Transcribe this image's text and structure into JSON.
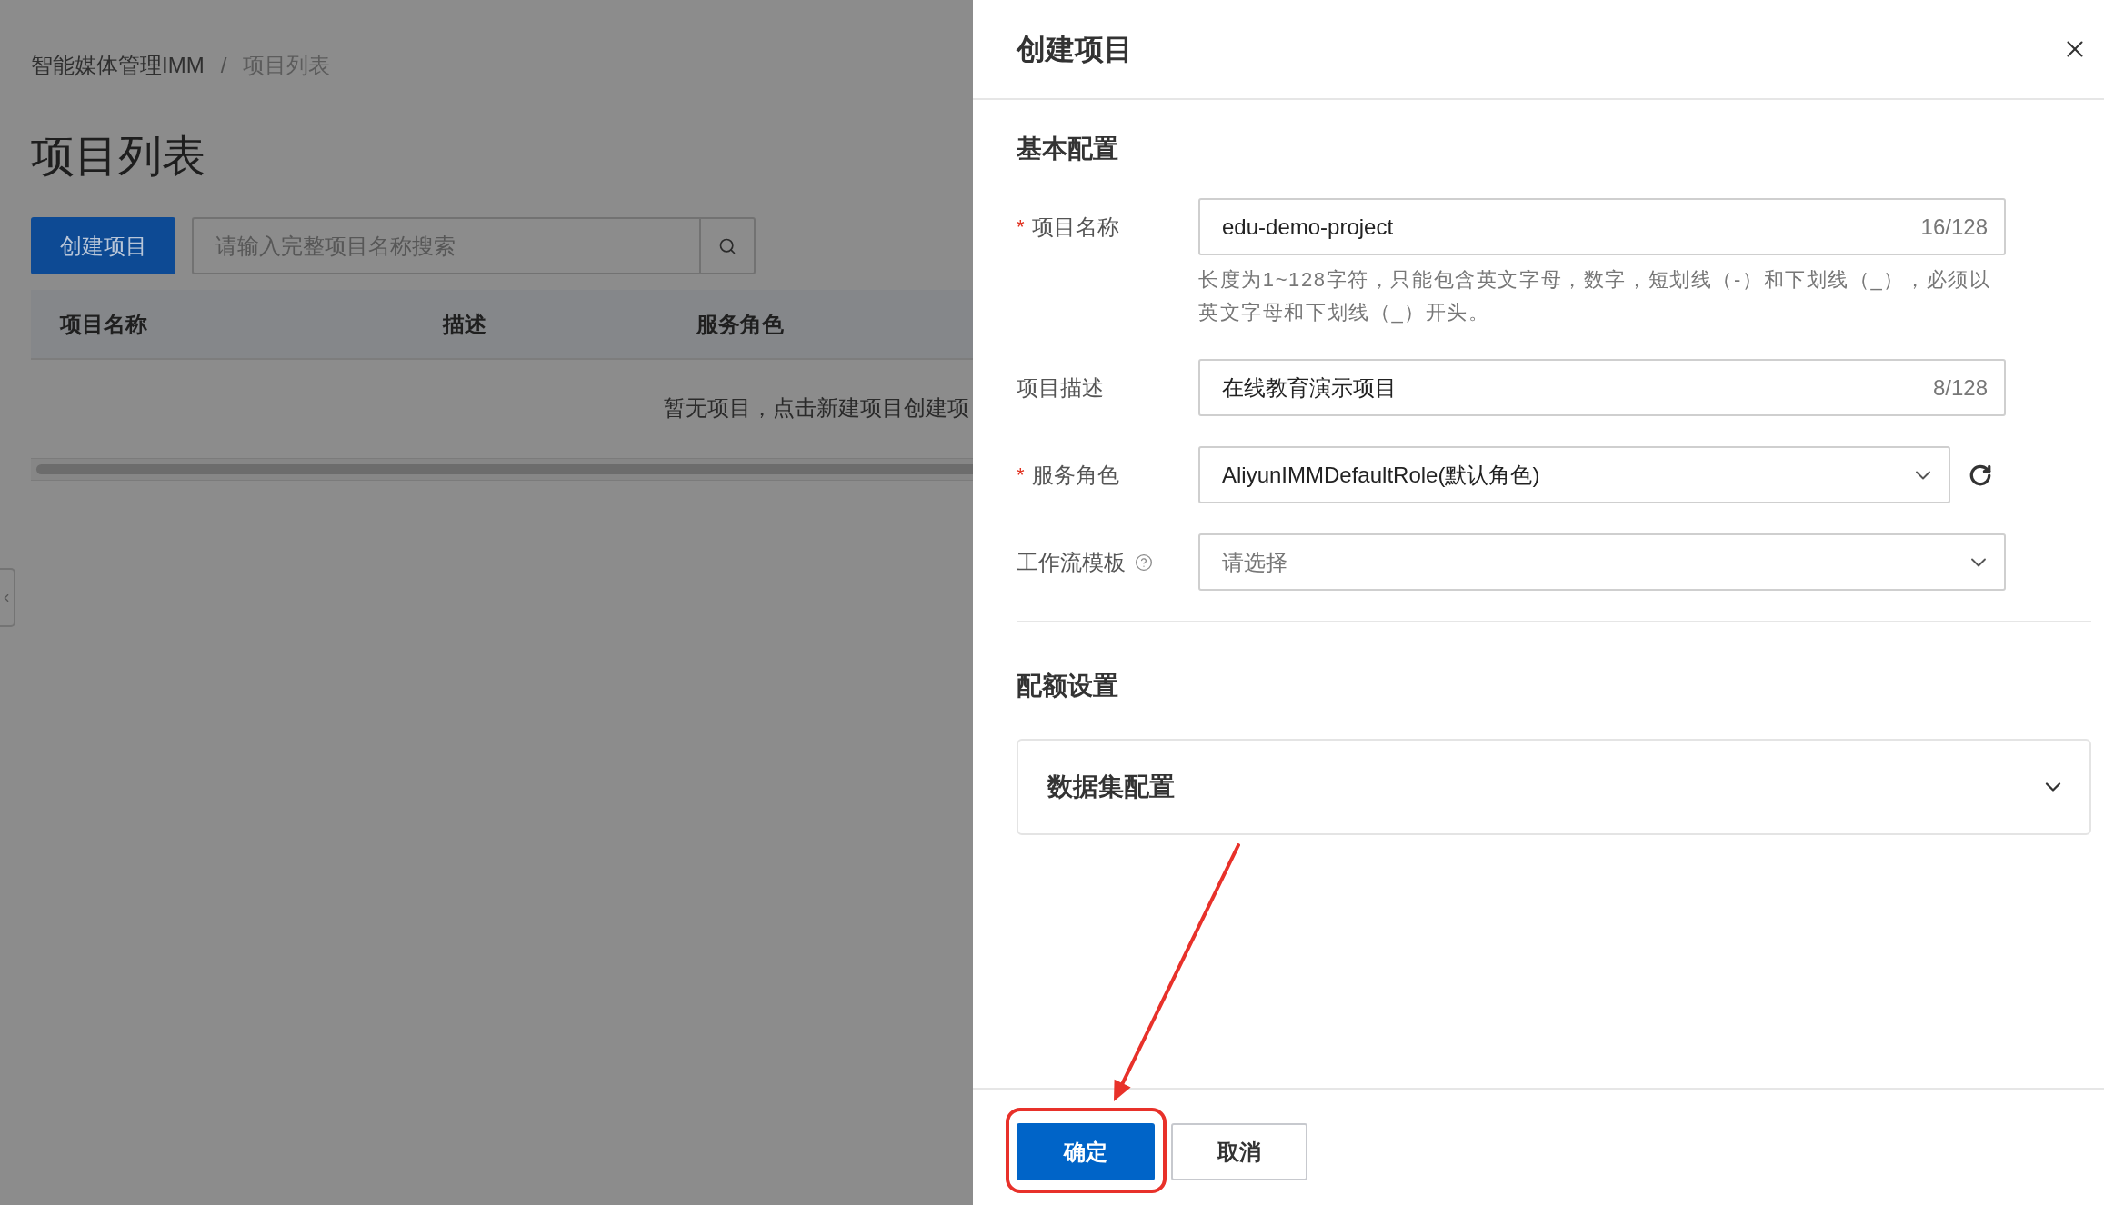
{
  "breadcrumb": {
    "items": [
      "智能媒体管理IMM",
      "项目列表"
    ],
    "separator": "/"
  },
  "page_title": "项目列表",
  "toolbar": {
    "create_button": "创建项目",
    "search": {
      "placeholder": "请输入完整项目名称搜索"
    }
  },
  "table": {
    "columns": [
      "项目名称",
      "描述",
      "服务角色"
    ],
    "empty_text": "暂无项目，点击新建项目创建项"
  },
  "drawer": {
    "title": "创建项目",
    "required_mark": "*",
    "sections": [
      {
        "kind": "form",
        "title": "基本配置",
        "fields": [
          {
            "kind": "text",
            "label": "项目名称",
            "required": true,
            "has_help": false,
            "has_refresh": false,
            "value": "edu-demo-project",
            "counter": "16/128",
            "help": "长度为1~128字符，只能包含英文字母，数字，短划线（-）和下划线（_），必须以英文字母和下划线（_）开头。"
          },
          {
            "kind": "text",
            "label": "项目描述",
            "required": false,
            "has_help": false,
            "has_refresh": false,
            "value": "在线教育演示项目",
            "counter": "8/128"
          },
          {
            "kind": "select",
            "label": "服务角色",
            "required": true,
            "has_help": false,
            "has_refresh": true,
            "value": "AliyunIMMDefaultRole(默认角色)"
          },
          {
            "kind": "select",
            "label": "工作流模板",
            "required": false,
            "has_help": true,
            "has_refresh": false,
            "placeholder": "请选择"
          }
        ]
      },
      {
        "kind": "collapse",
        "title": "配额设置",
        "panels": [
          {
            "title": "数据集配置",
            "expanded": false
          }
        ]
      }
    ],
    "footer_buttons": [
      {
        "label": "确定",
        "kind": "primary",
        "highlighted": true
      },
      {
        "label": "取消",
        "kind": "secondary",
        "highlighted": false
      }
    ]
  }
}
